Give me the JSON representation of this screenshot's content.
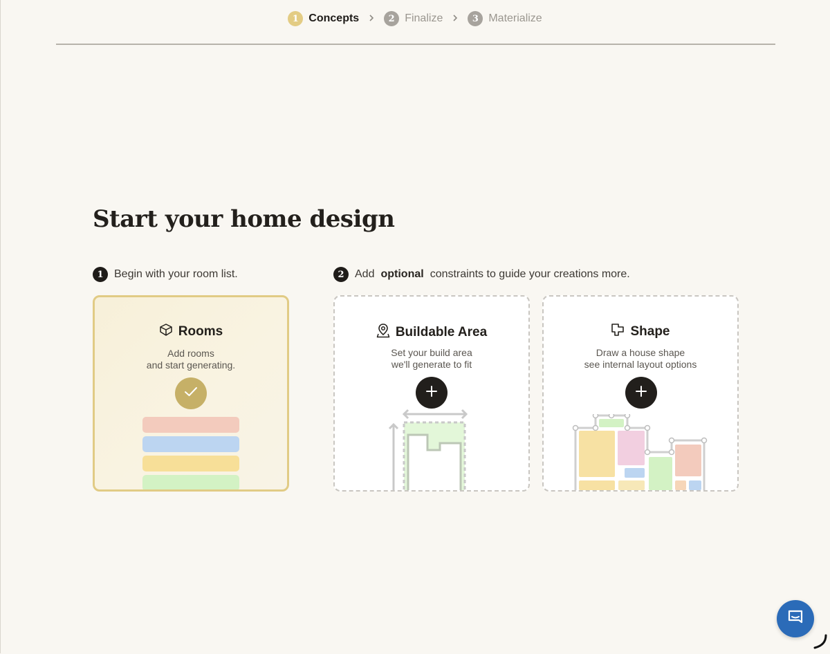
{
  "stepper": {
    "steps": [
      {
        "num": "1",
        "label": "Concepts"
      },
      {
        "num": "2",
        "label": "Finalize"
      },
      {
        "num": "3",
        "label": "Materialize"
      }
    ]
  },
  "main": {
    "title": "Start your home design",
    "step1": {
      "num": "1",
      "text": "Begin with your room list."
    },
    "step2": {
      "num": "2",
      "prefix": "Add",
      "bold": "optional",
      "suffix": "constraints to guide your creations more."
    }
  },
  "cards": {
    "rooms": {
      "title": "Rooms",
      "desc_line1": "Add rooms",
      "desc_line2": "and start generating.",
      "icon": "cube-icon",
      "selected": true
    },
    "buildable": {
      "title": "Buildable Area",
      "desc_line1": "Set your build area",
      "desc_line2": "we'll generate to fit",
      "icon": "map-pin-icon"
    },
    "shape": {
      "title": "Shape",
      "desc_line1": "Draw a house shape",
      "desc_line2": "see internal layout options",
      "icon": "floorplan-shape-icon"
    }
  },
  "colors": {
    "accent_gold": "#e1cb85",
    "check_gold": "#c6b067",
    "room_bars": [
      "#f3cbbd",
      "#bcd5f1",
      "#f7df98",
      "#d3f2c4"
    ],
    "chat_blue": "#2b6bb8"
  },
  "widgets": {
    "chat_icon": "chat-icon"
  }
}
